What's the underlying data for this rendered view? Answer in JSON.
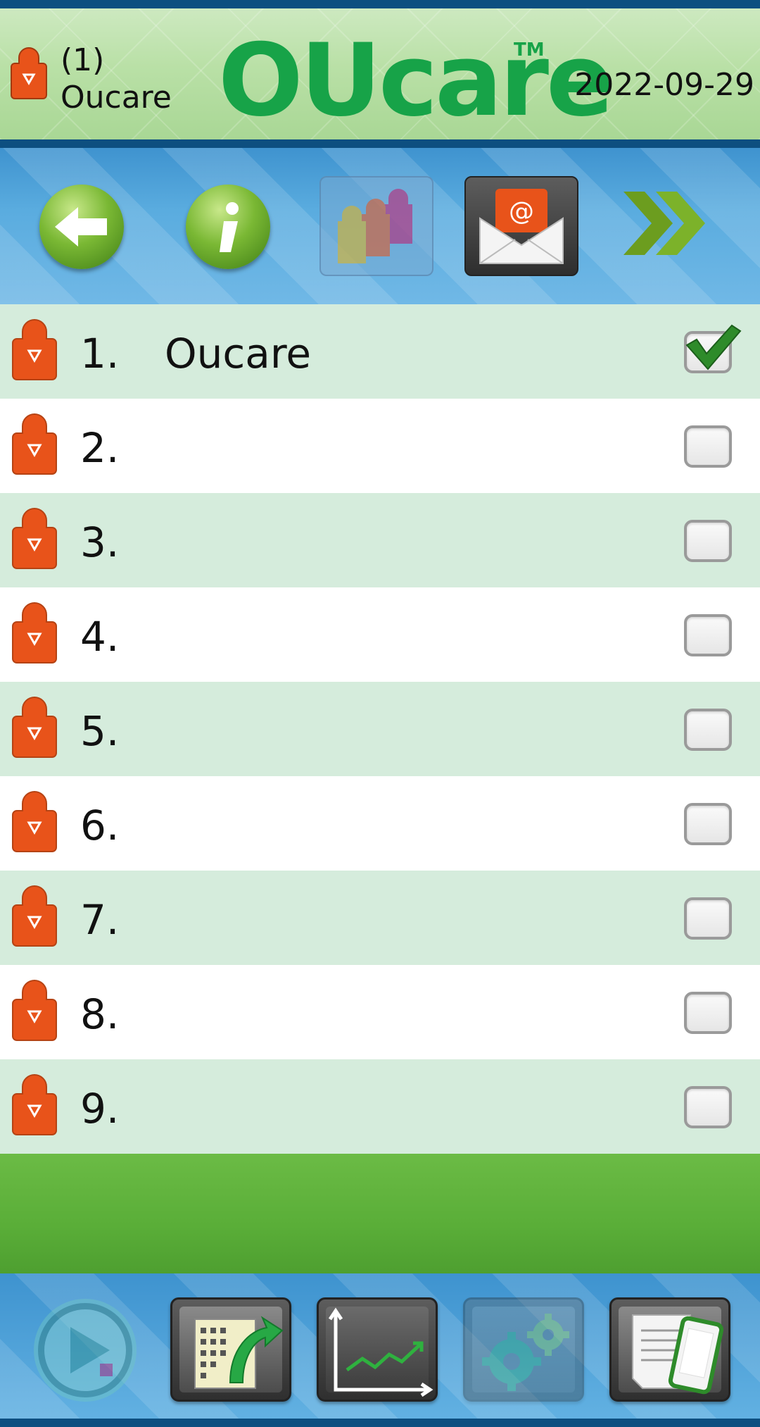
{
  "header": {
    "user_number": "(1)",
    "user_name": "Oucare",
    "logo_text": "OUcare",
    "logo_tm": "TM",
    "date": "2022-09-29"
  },
  "toolbar": {
    "buttons": [
      {
        "name": "back",
        "icon": "back-arrow-icon"
      },
      {
        "name": "info",
        "icon": "info-icon"
      },
      {
        "name": "users",
        "icon": "multi-user-icon",
        "enabled": false
      },
      {
        "name": "email",
        "icon": "email-icon"
      },
      {
        "name": "next",
        "icon": "double-chevron-right-icon"
      }
    ]
  },
  "users": [
    {
      "number": "1.",
      "name": "Oucare",
      "checked": true
    },
    {
      "number": "2.",
      "name": "",
      "checked": false
    },
    {
      "number": "3.",
      "name": "",
      "checked": false
    },
    {
      "number": "4.",
      "name": "",
      "checked": false
    },
    {
      "number": "5.",
      "name": "",
      "checked": false
    },
    {
      "number": "6.",
      "name": "",
      "checked": false
    },
    {
      "number": "7.",
      "name": "",
      "checked": false
    },
    {
      "number": "8.",
      "name": "",
      "checked": false
    },
    {
      "number": "9.",
      "name": "",
      "checked": false
    }
  ],
  "bottom_bar": {
    "buttons": [
      {
        "name": "play",
        "icon": "play-icon",
        "enabled": false
      },
      {
        "name": "transfer",
        "icon": "data-transfer-icon"
      },
      {
        "name": "chart",
        "icon": "line-chart-icon"
      },
      {
        "name": "settings",
        "icon": "gears-icon",
        "enabled": false
      },
      {
        "name": "phone-report",
        "icon": "phone-document-icon"
      }
    ]
  },
  "colors": {
    "brand_green": "#17a348",
    "user_icon_orange": "#e8531a",
    "row_alt": "#d5ecdc",
    "band_green": "#5aae38",
    "toolbar_blue": "#5aacdf",
    "frame_blue": "#0d4f80"
  }
}
